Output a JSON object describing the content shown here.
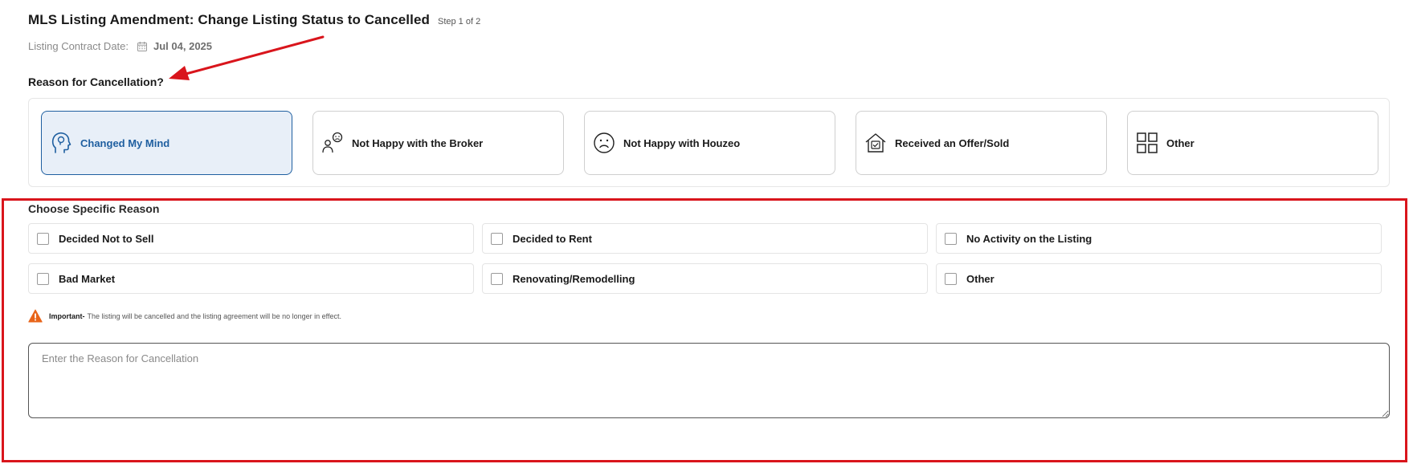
{
  "header": {
    "title": "MLS Listing Amendment: Change Listing Status to Cancelled",
    "step": "Step 1 of 2",
    "contract_date_label": "Listing Contract Date:",
    "contract_date_value": "Jul 04, 2025"
  },
  "reason": {
    "heading": "Reason for Cancellation?",
    "categories": [
      {
        "label": "Changed My Mind",
        "icon": "head-thought-icon",
        "selected": true
      },
      {
        "label": "Not Happy with the Broker",
        "icon": "unhappy-person-icon",
        "selected": false
      },
      {
        "label": "Not Happy with Houzeo",
        "icon": "sad-face-icon",
        "selected": false
      },
      {
        "label": "Received an Offer/Sold",
        "icon": "house-check-icon",
        "selected": false
      },
      {
        "label": "Other",
        "icon": "grid-icon",
        "selected": false
      }
    ]
  },
  "specific": {
    "heading": "Choose Specific Reason",
    "options": [
      {
        "label": "Decided Not to Sell",
        "checked": false
      },
      {
        "label": "Decided to Rent",
        "checked": false
      },
      {
        "label": "No Activity on the Listing",
        "checked": false
      },
      {
        "label": "Bad Market",
        "checked": false
      },
      {
        "label": "Renovating/Remodelling",
        "checked": false
      },
      {
        "label": "Other",
        "checked": false
      }
    ]
  },
  "notice": {
    "label": "Important-",
    "text": "The listing will be cancelled and the listing agreement will be no longer in effect."
  },
  "textarea": {
    "placeholder": "Enter the Reason for Cancellation",
    "value": ""
  },
  "colors": {
    "accent": "#1f5fa0",
    "selected_bg": "#e8eff8",
    "annotation_red": "#d9151c",
    "warning_orange": "#e8651a"
  }
}
